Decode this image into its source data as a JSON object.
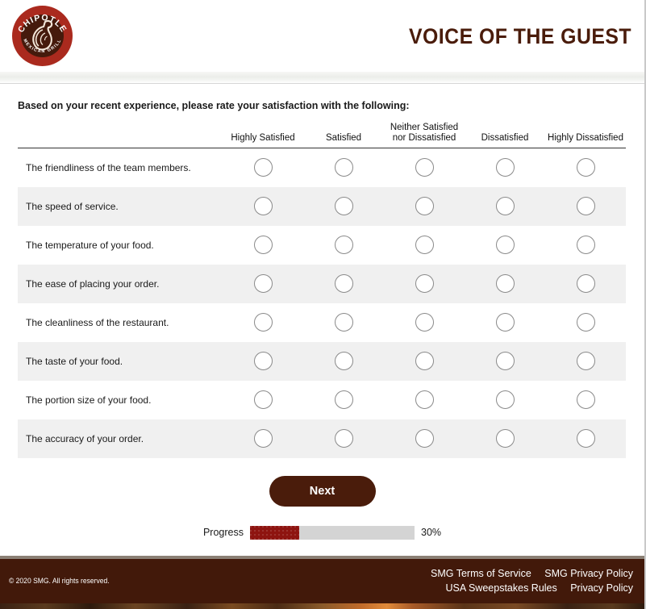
{
  "header": {
    "brand_title": "VOICE OF THE GUEST",
    "logo": {
      "name": "chipotle-logo",
      "top_text": "CHIPOTLE",
      "bottom_text": "MEXICAN GRILL",
      "ring_color": "#aa2a1e",
      "inner_color": "#451a0c"
    }
  },
  "survey": {
    "question": "Based on your recent experience, please rate your satisfaction with the following:",
    "columns": [
      "Highly Satisfied",
      "Satisfied",
      "Neither Satisfied nor Dissatisfied",
      "Dissatisfied",
      "Highly Dissatisfied"
    ],
    "rows": [
      "The friendliness of the team members.",
      "The speed of service.",
      "The temperature of your food.",
      "The ease of placing your order.",
      "The cleanliness of the restaurant.",
      "The taste of your food.",
      "The portion size of your food.",
      "The accuracy of your order."
    ],
    "selected": [
      null,
      null,
      null,
      null,
      null,
      null,
      null,
      null
    ]
  },
  "actions": {
    "next_label": "Next",
    "next_color": "#4a1c0b"
  },
  "progress": {
    "label": "Progress",
    "percent_text": "30%",
    "percent_value": 30,
    "fill_color": "#8e1410",
    "track_color": "#d4d4d4"
  },
  "footer": {
    "copyright": "© 2020 SMG. All rights reserved.",
    "background": "#42190a",
    "links_row1": [
      "SMG Terms of Service",
      "SMG Privacy Policy"
    ],
    "links_row2": [
      "USA Sweepstakes Rules",
      "Privacy Policy"
    ]
  }
}
